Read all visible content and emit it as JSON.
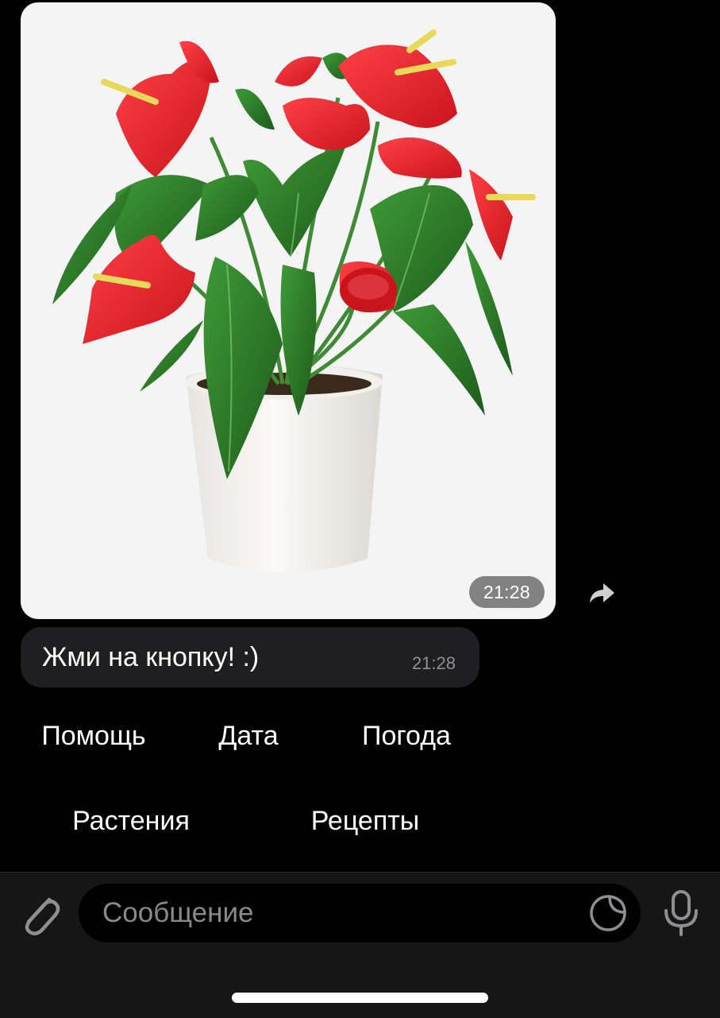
{
  "chat": {
    "photo_message": {
      "time": "21:28"
    },
    "text_message": {
      "text": "Жми на кнопку! :)",
      "time": "21:28"
    }
  },
  "keyboard": {
    "rows": [
      [
        "Помощь",
        "Дата",
        "Погода"
      ],
      [
        "Растения",
        "Рецепты"
      ]
    ]
  },
  "composer": {
    "placeholder": "Сообщение"
  },
  "icons": {
    "share": "share-arrow-icon",
    "attach": "paperclip-icon",
    "sticker": "sticker-icon",
    "mic": "microphone-icon"
  },
  "colors": {
    "background": "#000000",
    "bubble": "#1f1f21",
    "input_bar": "#161617",
    "flower_red": "#e8232c",
    "leaf_green": "#2f7d2a"
  }
}
